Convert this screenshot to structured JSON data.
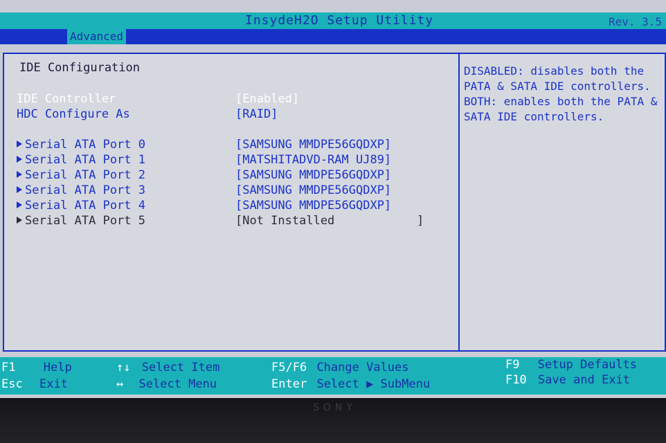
{
  "header": {
    "title": "InsydeH2O Setup Utility",
    "revision": "Rev. 3.5"
  },
  "menu": {
    "active_tab": "Advanced"
  },
  "section": {
    "title": "IDE Configuration"
  },
  "settings": [
    {
      "label": "IDE Controller",
      "value": "[Enabled]"
    },
    {
      "label": "HDC Configure As",
      "value": "[RAID]"
    }
  ],
  "ports": [
    {
      "label": "Serial ATA Port 0",
      "value": "[SAMSUNG MMDPE56GQDXP]"
    },
    {
      "label": "Serial ATA Port 1",
      "value": "[MATSHITADVD-RAM UJ89]"
    },
    {
      "label": "Serial ATA Port 2",
      "value": "[SAMSUNG MMDPE56GQDXP]"
    },
    {
      "label": "Serial ATA Port 3",
      "value": "[SAMSUNG MMDPE56GQDXP]"
    },
    {
      "label": "Serial ATA Port 4",
      "value": "[SAMSUNG MMDPE56GQDXP]"
    },
    {
      "label": "Serial ATA Port 5",
      "value": "[Not Installed",
      "close": "]"
    }
  ],
  "help_text": "DISABLED: disables both the PATA & SATA IDE controllers. BOTH: enables both the PATA & SATA IDE controllers.",
  "footer": {
    "f1_key": "F1",
    "f1_desc": "Help",
    "esc_key": "Esc",
    "esc_desc": "Exit",
    "updown_key": "↑↓",
    "updown_desc": "Select Item",
    "leftright_key": "↔",
    "leftright_desc": "Select Menu",
    "f5f6_key": "F5/F6",
    "f5f6_desc": "Change Values",
    "enter_key": "Enter",
    "enter_desc": "Select ▶ SubMenu",
    "f9_key": "F9",
    "f9_desc": "Setup Defaults",
    "f10_key": "F10",
    "f10_desc": "Save and Exit"
  },
  "bezel": {
    "brand": "SONY"
  },
  "colors": {
    "accent_teal": "#1ab2b8",
    "bios_blue": "#1731c8",
    "panel_grey": "#d6d8e0",
    "highlight_white": "#ffffff"
  }
}
